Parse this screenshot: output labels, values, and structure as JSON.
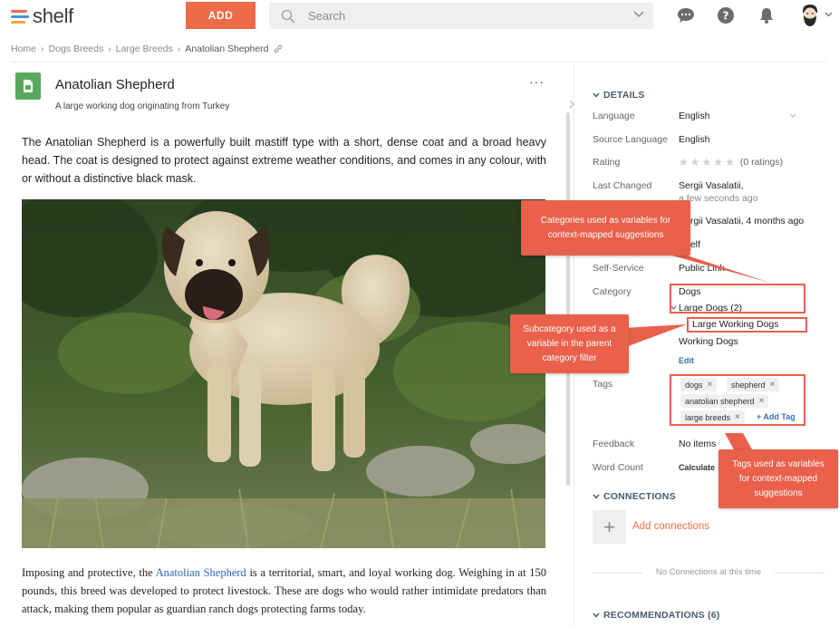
{
  "app": {
    "logo_text": "shelf",
    "brand_color": "#ef6a47"
  },
  "topbar": {
    "add_label": "ADD",
    "search_placeholder": "Search",
    "icons": [
      "chat-icon",
      "help-icon",
      "bell-icon",
      "avatar",
      "chevron-down-icon"
    ]
  },
  "breadcrumb": [
    "Home",
    "Dogs Breeds",
    "Large Breeds",
    "Anatolian Shepherd"
  ],
  "article": {
    "title": "Anatolian Shepherd",
    "subtitle": "A large working dog originating from Turkey",
    "more": "···",
    "intro": "The Anatolian Shepherd is a powerfully built mastiff type with a short, dense coat and a broad heavy head. The coat is designed to protect against extreme weather conditions, and comes in any colour, with or without a distinctive black mask.",
    "body_before": "Imposing and protective, the ",
    "body_link": "Anatolian Shepherd",
    "body_after": " is a territorial, smart, and loyal working dog. Weighing in at 150 pounds, this breed was developed to protect livestock. These are dogs who would rather intimidate predators than attack, making them popular as guardian ranch dogs protecting farms today."
  },
  "details": {
    "heading": "DETAILS",
    "language_label": "Language",
    "language_value": "English",
    "source_language_label": "Source Language",
    "source_language_value": "English",
    "rating_label": "Rating",
    "rating_value": "(0 ratings)",
    "rating_stars": 0,
    "last_changed_label": "Last Changed",
    "last_changed_user": "Sergii Vasalatii,",
    "last_changed_time": "a few seconds ago",
    "created_user": "Sergii Vasalatii, 4 months ago",
    "gem_value": "Shelf",
    "self_service_label": "Self-Service",
    "self_service_value": "Public Link",
    "category_label": "Category",
    "category_items": [
      "Dogs",
      "Large Dogs (2)",
      "Large Working Dogs",
      "Working Dogs"
    ],
    "category_edit": "Edit",
    "tags_label": "Tags",
    "tags": [
      "dogs",
      "shepherd",
      "anatolian shepherd",
      "large breeds"
    ],
    "add_tag": "+ Add Tag",
    "feedback_label": "Feedback",
    "feedback_value": "No items",
    "word_count_label": "Word Count",
    "word_count_value": "Calculate"
  },
  "connections": {
    "heading": "CONNECTIONS",
    "add_label": "Add connections",
    "empty": "No Connections at this time"
  },
  "recommendations": {
    "heading": "RECOMMENDATIONS (6)"
  },
  "annotations": {
    "categories": "Categories used as variables for context-mapped suggestions",
    "subcategory": "Subcategory used as a variable in the parent category filter",
    "tags": "Tags used as variables for context-mapped suggestions",
    "color": "#e9604b"
  }
}
